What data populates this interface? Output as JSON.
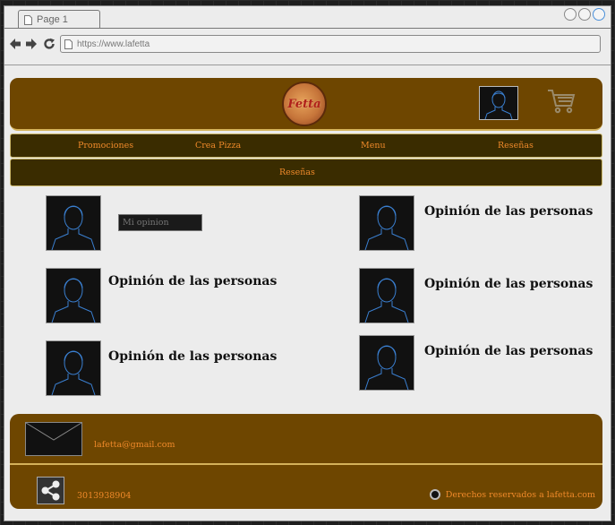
{
  "browser": {
    "tab_title": "Page 1",
    "url": "https://www.lafetta"
  },
  "header": {
    "logo_text": "Fetta",
    "icons": [
      "profile-icon",
      "shopping-cart-icon"
    ]
  },
  "nav": {
    "items": [
      "Promociones",
      "Crea Pizza",
      "Menu",
      "Reseñas"
    ],
    "sub_item": "Reseñas"
  },
  "reviews": {
    "my_opinion_placeholder": "Mi opinion",
    "left": [
      "Opinión de las personas",
      "Opinión de las personas"
    ],
    "right": [
      "Opinión de las personas",
      "Opinión de las personas",
      "Opinión de las personas"
    ]
  },
  "footer": {
    "email": "lafetta@gmail.com",
    "phone": "3013938904",
    "copyright": "Derechos reservados a lafetta.com"
  },
  "colors": {
    "brand_brown": "#6e4600",
    "nav_dark": "#3a2c00",
    "accent_orange": "#f08a2a"
  }
}
